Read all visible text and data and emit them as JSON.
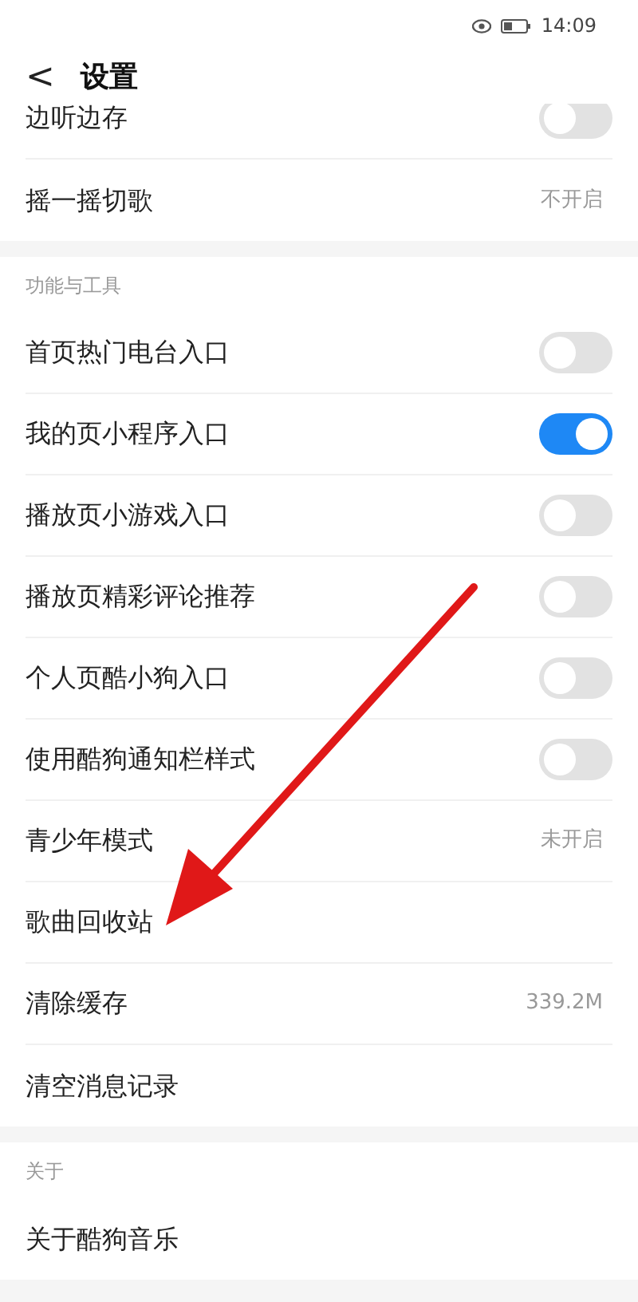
{
  "status_bar": {
    "time": "14:09"
  },
  "header": {
    "back": "<",
    "title": "设置"
  },
  "sections": [
    {
      "items": [
        {
          "kind": "toggle",
          "label": "边听边存",
          "on": false
        },
        {
          "kind": "value",
          "label": "摇一摇切歌",
          "value": "不开启"
        }
      ]
    },
    {
      "title": "功能与工具",
      "items": [
        {
          "kind": "toggle",
          "label": "首页热门电台入口",
          "on": false
        },
        {
          "kind": "toggle",
          "label": "我的页小程序入口",
          "on": true
        },
        {
          "kind": "toggle",
          "label": "播放页小游戏入口",
          "on": false
        },
        {
          "kind": "toggle",
          "label": "播放页精彩评论推荐",
          "on": false
        },
        {
          "kind": "toggle",
          "label": "个人页酷小狗入口",
          "on": false
        },
        {
          "kind": "toggle",
          "label": "使用酷狗通知栏样式",
          "on": false
        },
        {
          "kind": "value",
          "label": "青少年模式",
          "value": "未开启"
        },
        {
          "kind": "link",
          "label": "歌曲回收站"
        },
        {
          "kind": "value",
          "label": "清除缓存",
          "value": "339.2M"
        },
        {
          "kind": "link",
          "label": "清空消息记录"
        }
      ]
    },
    {
      "title": "关于",
      "items": [
        {
          "kind": "link",
          "label": "关于酷狗音乐"
        }
      ]
    }
  ]
}
